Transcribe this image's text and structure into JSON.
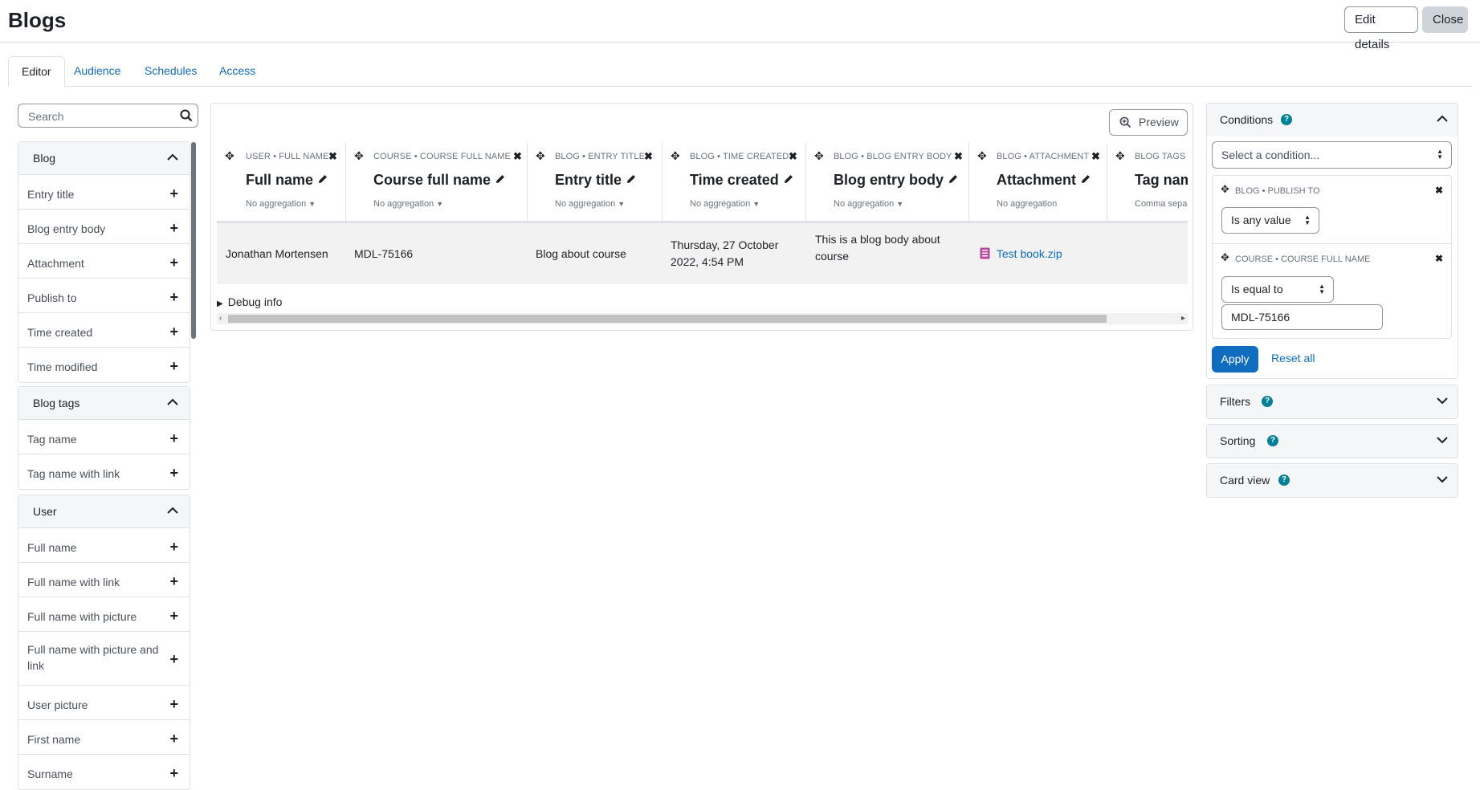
{
  "page": {
    "title": "Blogs"
  },
  "header": {
    "edit_label": "Edit details",
    "close_label": "Close"
  },
  "tabs": [
    {
      "label": "Editor",
      "active": true
    },
    {
      "label": "Audience"
    },
    {
      "label": "Schedules"
    },
    {
      "label": "Access"
    }
  ],
  "sidebar": {
    "search_placeholder": "Search",
    "groups": [
      {
        "title": "Blog",
        "items": [
          "Entry title",
          "Blog entry body",
          "Attachment",
          "Publish to",
          "Time created",
          "Time modified"
        ]
      },
      {
        "title": "Blog tags",
        "items": [
          "Tag name",
          "Tag name with link"
        ]
      },
      {
        "title": "User",
        "items": [
          "Full name",
          "Full name with link",
          "Full name with picture",
          "Full name with picture and link",
          "User picture",
          "First name",
          "Surname"
        ]
      }
    ]
  },
  "report": {
    "preview_label": "Preview",
    "columns": [
      {
        "source": "USER • FULL NAME",
        "name": "Full name",
        "aggregation": "No aggregation"
      },
      {
        "source": "COURSE • COURSE FULL NAME",
        "name": "Course full name",
        "aggregation": "No aggregation"
      },
      {
        "source": "BLOG • ENTRY TITLE",
        "name": "Entry title",
        "aggregation": "No aggregation"
      },
      {
        "source": "BLOG • TIME CREATED",
        "name": "Time created",
        "aggregation": "No aggregation"
      },
      {
        "source": "BLOG • BLOG ENTRY BODY",
        "name": "Blog entry body",
        "aggregation": "No aggregation"
      },
      {
        "source": "BLOG • ATTACHMENT",
        "name": "Attachment",
        "aggregation": "No aggregation"
      },
      {
        "source": "BLOG TAGS",
        "name": "Tag nam",
        "aggregation": "Comma sepa"
      }
    ],
    "row": {
      "full_name": "Jonathan Mortensen",
      "course": "MDL-75166",
      "entry_title": "Blog about course",
      "time_created_1": "Thursday, 27 October",
      "time_created_2": "2022, 4:54 PM",
      "body_1": "This is a blog body about",
      "body_2": "course",
      "attachment": "Test book.zip"
    },
    "debug_label": "Debug info"
  },
  "conditions": {
    "title": "Conditions",
    "select_placeholder": "Select a condition...",
    "items": [
      {
        "name": "BLOG • PUBLISH TO",
        "operator": "Is any value"
      },
      {
        "name": "COURSE • COURSE FULL NAME",
        "operator": "Is equal to",
        "value": "MDL-75166"
      }
    ],
    "apply_label": "Apply",
    "reset_label": "Reset all"
  },
  "panels": {
    "filters": "Filters",
    "sorting": "Sorting",
    "card_view": "Card view"
  },
  "icons": {
    "help": "?",
    "plus": "+",
    "move": "✥",
    "remove": "✖",
    "edit": "pencil-icon"
  }
}
